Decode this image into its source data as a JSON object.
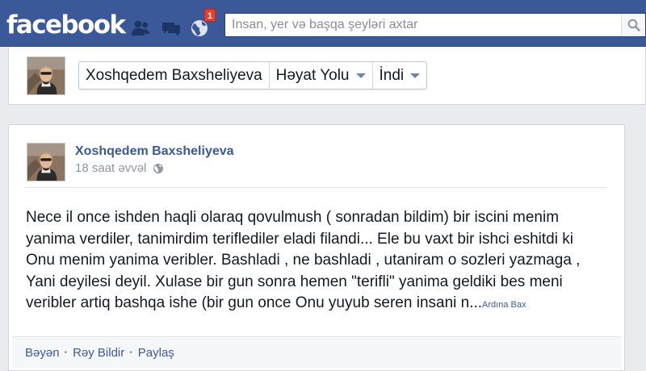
{
  "header": {
    "logo_text": "facebook",
    "search_placeholder": "İnsan, yer və başqa şeyləri axtar",
    "notification_count": "1",
    "jewels": [
      "friends-icon",
      "messages-icon",
      "notifications-globe-icon"
    ]
  },
  "timeline_bar": {
    "name": "Xoshqedem Baxsheliyeva",
    "section": "Həyat Yolu",
    "period": "İndi"
  },
  "post": {
    "author": "Xoshqedem Baxsheliyeva",
    "timestamp": "18 saat əvvəl",
    "privacy_icon": "globe-icon",
    "text": "Nece il once ishden haqli olaraq qovulmush ( sonradan bildim) bir iscini menim\nyanima verdiler, tanimirdim teriflediler eladi filandi... Ele bu vaxt bir ishci eshitdi ki\nOnu menim yanima veribler. Bashladi , ne bashladi , utaniram o sozleri yazmaga ,\nYani deyilesi deyil. Xulase bir gun sonra hemen \"terifli\" yanima geldiki bes meni\nveribler artiq bashqa ishe (bir gun once Onu yuyub seren insani n...",
    "more_link": "Ardına Bax",
    "actions": {
      "like": "Bəyən",
      "comment": "Rəy Bildir",
      "share": "Paylaş"
    }
  },
  "colors": {
    "brand_blue": "#3b5998",
    "link_blue": "#3b5998",
    "badge_red": "#f03d25"
  }
}
